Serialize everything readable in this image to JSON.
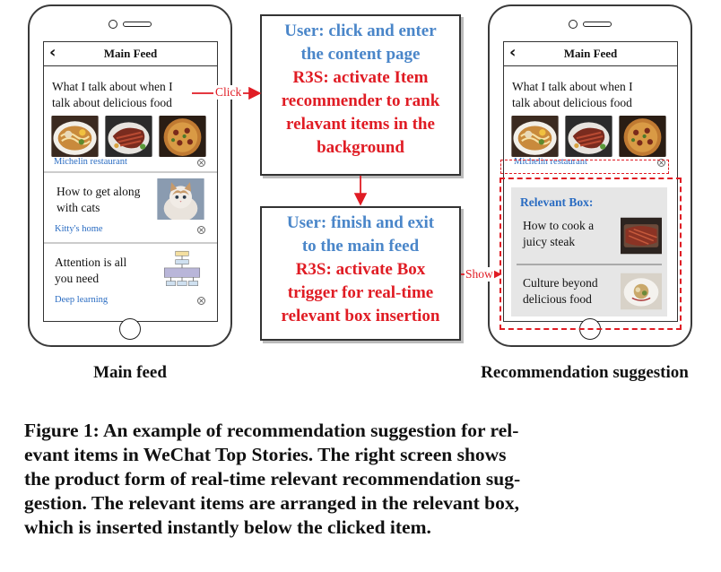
{
  "left_phone": {
    "header_title": "Main Feed",
    "label": "Main feed",
    "items": [
      {
        "text_line1": "What I talk about when I",
        "text_line2": "talk about delicious food",
        "source": "Michelin restaurant"
      },
      {
        "text_line1": "How to get along",
        "text_line2": "with cats",
        "source": "Kitty's home"
      },
      {
        "text_line1": "Attention is all",
        "text_line2": "you need",
        "source": "Deep learning"
      }
    ]
  },
  "right_phone": {
    "header_title": "Main Feed",
    "label": "Recommendation suggestion",
    "item": {
      "text_line1": "What I talk about when I",
      "text_line2": "talk about delicious food",
      "source": "Michelin restaurant"
    },
    "relevant_box": {
      "title": "Relevant Box:",
      "items": [
        {
          "text_line1": "How to cook a",
          "text_line2": "juicy steak"
        },
        {
          "text_line1": "Culture beyond",
          "text_line2": "delicious food"
        }
      ]
    }
  },
  "flow": {
    "box1": {
      "user_line1": "User: click and enter",
      "user_line2": "the content page",
      "r3s_line1": "R3S: activate Item",
      "r3s_line2": "recommender to rank",
      "r3s_line3": "relavant items in the",
      "r3s_line4": "background"
    },
    "box2": {
      "user_line1": "User: finish and exit",
      "user_line2": "to the main feed",
      "r3s_line1": "R3S: activate Box",
      "r3s_line2": "trigger for real-time",
      "r3s_line3": "relevant box insertion"
    },
    "click_label": "Click",
    "show_label": "Show"
  },
  "caption": {
    "line1": "Figure 1: An example of recommendation suggestion for rel-",
    "line2": "evant items in WeChat Top Stories. The right screen shows",
    "line3": "the product form of real-time relevant recommendation sug-",
    "line4": "gestion. The relevant items are arranged in the relevant box,",
    "line5": "which is inserted instantly below the clicked item."
  },
  "colors": {
    "blue": "#4a86c9",
    "red": "#e01c24",
    "link": "#2a6cc2"
  }
}
